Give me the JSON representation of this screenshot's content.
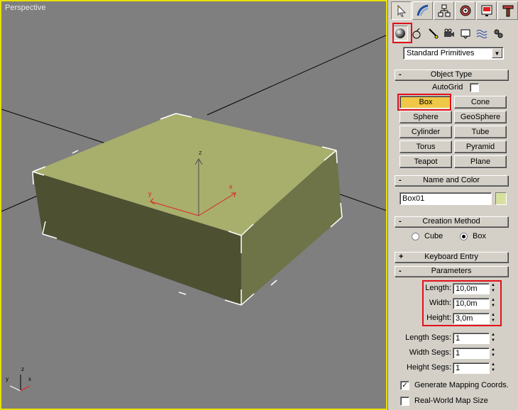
{
  "viewport": {
    "label": "Perspective",
    "axis_labels": {
      "x": "x",
      "y": "y",
      "z": "z"
    }
  },
  "panel": {
    "tabs": [
      "create-icon",
      "modify-icon",
      "hierarchy-icon",
      "motion-icon",
      "display-icon",
      "utilities-icon"
    ],
    "subtabs": [
      "geometry-icon",
      "shapes-icon",
      "lights-icon",
      "cameras-icon",
      "helpers-icon",
      "spacewarps-icon",
      "systems-icon"
    ],
    "category": "Standard Primitives",
    "object_type": {
      "title": "Object Type",
      "autogrid_label": "AutoGrid",
      "buttons": [
        "Box",
        "Cone",
        "Sphere",
        "GeoSphere",
        "Cylinder",
        "Tube",
        "Torus",
        "Pyramid",
        "Teapot",
        "Plane"
      ],
      "selected": "Box"
    },
    "name_color": {
      "title": "Name and Color",
      "name": "Box01",
      "color": "#d8e0a0"
    },
    "creation_method": {
      "title": "Creation Method",
      "option_cube": "Cube",
      "option_box": "Box",
      "selected": "Box"
    },
    "keyboard_entry": {
      "title": "Keyboard Entry"
    },
    "parameters": {
      "title": "Parameters",
      "length_label": "Length:",
      "length": "10,0m",
      "width_label": "Width:",
      "width": "10,0m",
      "height_label": "Height:",
      "height": "3,0m",
      "length_segs_label": "Length Segs:",
      "length_segs": "1",
      "width_segs_label": "Width Segs:",
      "width_segs": "1",
      "height_segs_label": "Height Segs:",
      "height_segs": "1",
      "gen_mapping_label": "Generate Mapping Coords.",
      "gen_mapping": true,
      "real_world_label": "Real-World Map Size",
      "real_world": false
    }
  },
  "colors": {
    "highlight": "#e0101a",
    "viewport_border": "#e8e000",
    "box_top": "#a8ae6c",
    "box_front": "#4e5032",
    "box_right": "#6e7448",
    "selected_button": "#f0c848"
  }
}
